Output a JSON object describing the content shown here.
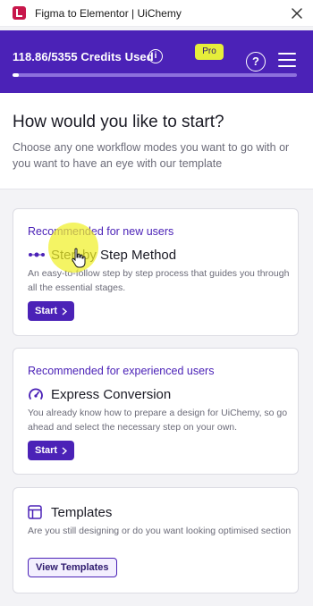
{
  "titlebar": {
    "title": "Figma to Elementor | UiChemy"
  },
  "header": {
    "credits_text": "118.86/5355 Credits Used",
    "info_glyph": "i",
    "plan_badge": "Pro",
    "help_glyph": "?",
    "credits_progress_percent": 2.2
  },
  "intro": {
    "heading": "How would you like to start?",
    "subtext": "Choose any one workflow modes you want to go with or you want to have an eye with our template"
  },
  "cards": [
    {
      "reco": "Recommended for new users",
      "name": "Step by Step Method",
      "desc": "An easy-to-follow step by step process that guides you through all the essential stages.",
      "button": "Start",
      "icon": "steps-icon"
    },
    {
      "reco": "Recommended for experienced users",
      "name": "Express Conversion",
      "desc": "You already know how to prepare a design for UiChemy, so go ahead and select the necessary step on your own.",
      "button": "Start",
      "icon": "speedometer-icon"
    },
    {
      "name": "Templates",
      "desc": "Are you still designing or do you want looking optimised section",
      "button": "View Templates",
      "icon": "template-layout-icon"
    }
  ],
  "colors": {
    "brand": "#4b22b7",
    "logo": "#c8174b",
    "badge": "#e6ee3a"
  }
}
